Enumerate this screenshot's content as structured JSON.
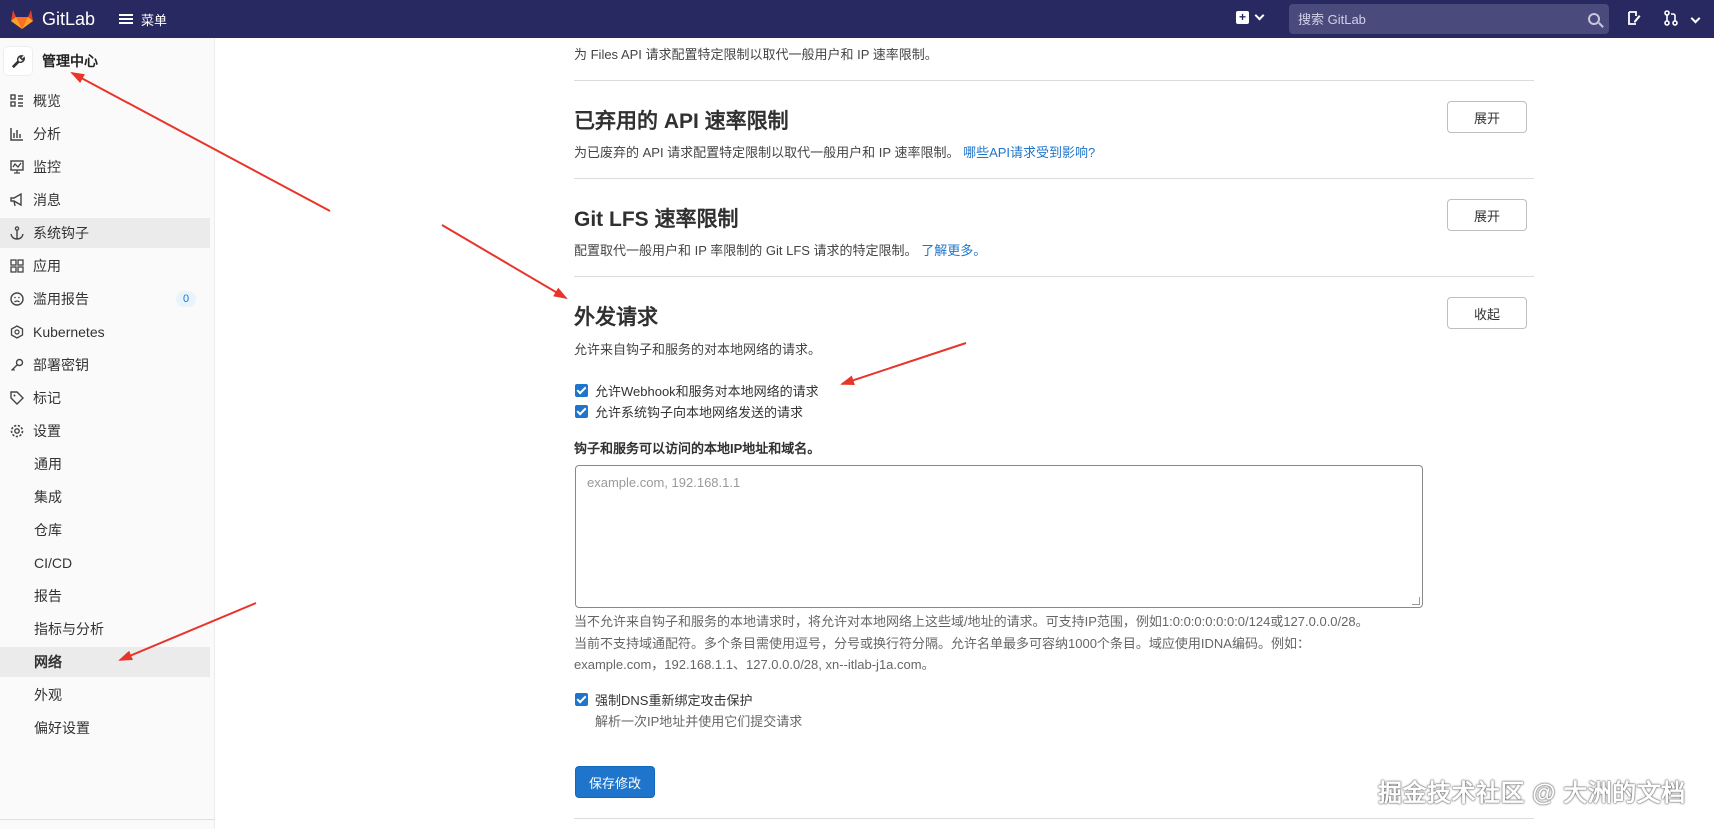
{
  "header": {
    "app_name": "GitLab",
    "menu_label": "菜单",
    "search_placeholder": "搜索 GitLab"
  },
  "sidebar": {
    "title": "管理中心",
    "items": [
      {
        "label": "概览",
        "icon": "overview-icon"
      },
      {
        "label": "分析",
        "icon": "analytics-icon"
      },
      {
        "label": "监控",
        "icon": "monitor-icon"
      },
      {
        "label": "消息",
        "icon": "megaphone-icon"
      },
      {
        "label": "系统钩子",
        "icon": "anchor-icon"
      },
      {
        "label": "应用",
        "icon": "applications-icon"
      },
      {
        "label": "滥用报告",
        "icon": "abuse-report-icon",
        "badge": "0"
      },
      {
        "label": "Kubernetes",
        "icon": "kubernetes-icon"
      },
      {
        "label": "部署密钥",
        "icon": "key-icon"
      },
      {
        "label": "标记",
        "icon": "label-icon"
      },
      {
        "label": "设置",
        "icon": "settings-icon"
      }
    ],
    "settings_subitems": [
      "通用",
      "集成",
      "仓库",
      "CI/CD",
      "报告",
      "指标与分析",
      "网络",
      "外观",
      "偏好设置"
    ],
    "active_subitem": "网络"
  },
  "content": {
    "top_desc": "为 Files API 请求配置特定限制以取代一般用户和 IP 速率限制。",
    "deprecated": {
      "title": "已弃用的 API 速率限制",
      "desc": "为已废弃的 API 请求配置特定限制以取代一般用户和 IP 速率限制。",
      "link": "哪些API请求受到影响?",
      "button": "展开"
    },
    "lfs": {
      "title": "Git LFS 速率限制",
      "desc": "配置取代一般用户和 IP 率限制的 Git LFS 请求的特定限制。",
      "link": "了解更多。",
      "button": "展开"
    },
    "outbound": {
      "title": "外发请求",
      "desc": "允许来自钩子和服务的对本地网络的请求。",
      "button": "收起",
      "checkbox1": "允许Webhook和服务对本地网络的请求",
      "checkbox2": "允许系统钩子向本地网络发送的请求",
      "field_label": "钩子和服务可以访问的本地IP地址和域名。",
      "textarea_placeholder": "example.com, 192.168.1.1",
      "help_line1": "当不允许来自钩子和服务的本地请求时，将允许对本地网络上这些域/地址的请求。可支持IP范围，例如1:0:0:0:0:0:0:0/124或127.0.0.0/28。",
      "help_line2": "当前不支持域通配符。多个条目需使用逗号，分号或换行符分隔。允许名单最多可容纳1000个条目。域应使用IDNA编码。例如：",
      "help_line3": "example.com，192.168.1.1、127.0.0.0/28, xn--itlab-j1a.com。",
      "checkbox3": "强制DNS重新绑定攻击保护",
      "checkbox3_sub": "解析一次IP地址并使用它们提交请求",
      "save_button": "保存修改"
    }
  },
  "watermark": "掘金技术社区 @ 大洲的文档",
  "colors": {
    "topbar": "#292961",
    "primary": "#1f75cb",
    "arrow": "#e8342a"
  }
}
